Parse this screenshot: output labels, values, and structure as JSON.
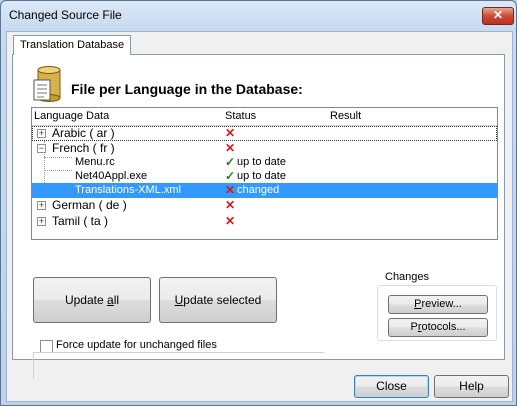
{
  "window": {
    "title": "Changed Source File",
    "close_symbol": "✕"
  },
  "tabs": [
    {
      "label": "Translation Database"
    }
  ],
  "heading": "File per Language in the Database:",
  "columns": {
    "language": "Language Data",
    "status": "Status",
    "result": "Result"
  },
  "tree": {
    "ar": {
      "expander": "+",
      "label": "Arabic ( ar )",
      "status_icon": "✕",
      "status_text": ""
    },
    "fr": {
      "expander": "−",
      "label": "French ( fr )",
      "status_icon": "✕",
      "status_text": ""
    },
    "fr_menu": {
      "label": "Menu.rc",
      "status_icon": "✓",
      "status_text": "up to date"
    },
    "fr_net": {
      "label": "Net40Appl.exe",
      "status_icon": "✓",
      "status_text": "up to date"
    },
    "fr_xml": {
      "label": "Translations-XML.xml",
      "status_icon": "✕",
      "status_text": "changed",
      "selected": true
    },
    "de": {
      "expander": "+",
      "label": "German ( de )",
      "status_icon": "✕",
      "status_text": ""
    },
    "ta": {
      "expander": "+",
      "label": "Tamil ( ta )",
      "status_icon": "✕",
      "status_text": ""
    }
  },
  "buttons": {
    "update_all": {
      "pre": "Update ",
      "accel": "a",
      "post": "ll"
    },
    "update_selected": {
      "pre": "",
      "accel": "U",
      "post": "pdate selected"
    },
    "preview": {
      "pre": "",
      "accel": "P",
      "post": "review..."
    },
    "protocols": {
      "pre": "P",
      "accel": "r",
      "post": "otocols..."
    },
    "close": "Close",
    "help": "Help"
  },
  "changes_group": {
    "title": "Changes"
  },
  "force_update": {
    "label": "Force update for unchanged files",
    "checked": false
  },
  "icons": {
    "database": "database-icon"
  }
}
